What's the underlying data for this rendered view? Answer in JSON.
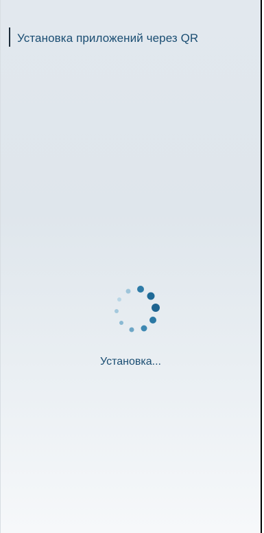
{
  "header": {
    "title": "Установка приложений через QR"
  },
  "loader": {
    "status_text": "Установка..."
  },
  "colors": {
    "accent": "#1f6a97",
    "text": "#1a4d72"
  },
  "icons": {
    "spinner": "loading-spinner-icon"
  }
}
